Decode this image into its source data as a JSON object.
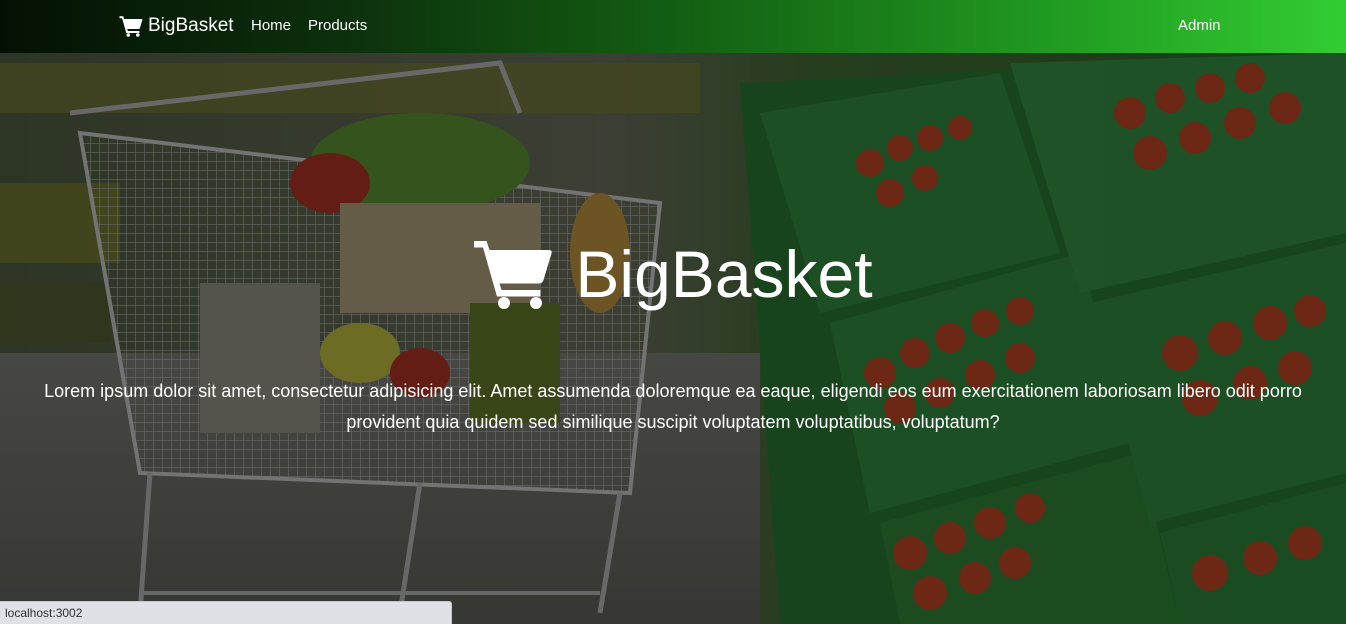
{
  "navbar": {
    "brand": {
      "icon": "shopping-cart-icon",
      "label": "BigBasket"
    },
    "links": {
      "home": "Home",
      "products": "Products"
    },
    "admin": "Admin"
  },
  "hero": {
    "icon": "shopping-cart-icon",
    "title": "BigBasket",
    "lead": "Lorem ipsum dolor sit amet, consectetur adipisicing elit. Amet assumenda doloremque ea eaque, eligendi eos eum exercitationem laboriosam libero odit porro provident quia quidem sed similique suscipit voluptatem voluptatibus, voluptatum?"
  },
  "status_bar": {
    "url": "localhost:3002"
  },
  "colors": {
    "navbar_start": "#041004",
    "navbar_end": "#32cd32",
    "text": "#ffffff",
    "status_bar_bg": "#dee1e6"
  }
}
